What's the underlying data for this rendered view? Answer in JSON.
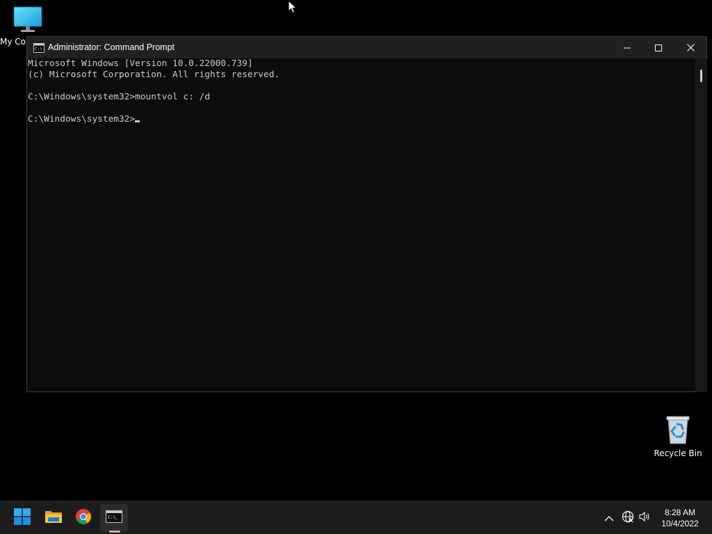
{
  "desktop": {
    "icons": [
      {
        "label": "My Computer",
        "icon": "monitor-icon"
      },
      {
        "label": "Recycle Bin",
        "icon": "recycle-bin-icon"
      }
    ]
  },
  "window": {
    "title": "Administrator: Command Prompt",
    "icon": "cmd-icon",
    "controls": {
      "minimize": "minimize-icon",
      "maximize": "maximize-icon",
      "close": "close-icon"
    }
  },
  "console": {
    "lines": [
      "Microsoft Windows [Version 10.0.22000.739]",
      "(c) Microsoft Corporation. All rights reserved.",
      "",
      "C:\\Windows\\system32>mountvol c: /d",
      "",
      "C:\\Windows\\system32>"
    ]
  },
  "taskbar": {
    "pinned": [
      {
        "name": "Start",
        "icon": "windows-logo-icon"
      },
      {
        "name": "File Explorer",
        "icon": "folder-icon"
      },
      {
        "name": "Google Chrome",
        "icon": "chrome-icon"
      },
      {
        "name": "Command Prompt",
        "icon": "cmd-icon",
        "active": true
      }
    ],
    "tray": {
      "icons": [
        "chevron-up-icon",
        "network-icon",
        "volume-icon"
      ],
      "time": "8:28 AM",
      "date": "10/4/2022"
    }
  },
  "colors": {
    "console_bg": "#0c0c0c",
    "console_text": "#cccccc",
    "titlebar_bg": "#202020",
    "taskbar_bg": "#1c1c1c",
    "desktop_bg": "#000000"
  }
}
